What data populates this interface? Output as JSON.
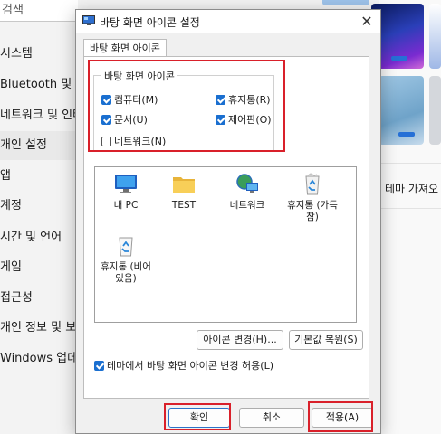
{
  "background": {
    "search_placeholder": "검색",
    "nav": [
      {
        "label": "시스템"
      },
      {
        "label": "Bluetooth 및 장치"
      },
      {
        "label": "네트워크 및 인터넷"
      },
      {
        "label": "개인 설정"
      },
      {
        "label": "앱"
      },
      {
        "label": "계정"
      },
      {
        "label": "시간 및 언어"
      },
      {
        "label": "게임"
      },
      {
        "label": "접근성"
      },
      {
        "label": "개인 정보 및 보안"
      },
      {
        "label": "Windows 업데이트"
      }
    ],
    "theme_text": "테마 가져오"
  },
  "dialog": {
    "title": "바탕 화면 아이콘 설정",
    "close_label": "✕",
    "tab": "바탕 화면 아이콘",
    "group_title": "바탕 화면 아이콘",
    "checkboxes": [
      {
        "label": "컴퓨터(M)",
        "checked": true
      },
      {
        "label": "휴지통(R)",
        "checked": true
      },
      {
        "label": "문서(U)",
        "checked": true
      },
      {
        "label": "제어판(O)",
        "checked": true
      },
      {
        "label": "네트워크(N)",
        "checked": false
      }
    ],
    "icons": [
      {
        "label": "내 PC",
        "icon": "monitor-icon"
      },
      {
        "label": "TEST",
        "icon": "folder-icon"
      },
      {
        "label": "네트워크",
        "icon": "network-icon"
      },
      {
        "label": "휴지통 (가득 참)",
        "icon": "recycle-bin-full-icon"
      },
      {
        "label": "휴지통 (비어 있음)",
        "icon": "recycle-bin-empty-icon"
      }
    ],
    "change_icon_button": "아이콘 변경(H)...",
    "restore_default_button": "기본값 복원(S)",
    "allow_themes": {
      "label": "테마에서 바탕 화면 아이콘 변경 허용(L)",
      "checked": true
    },
    "ok_button": "확인",
    "cancel_button": "취소",
    "apply_button": "적용(A)"
  },
  "colors": {
    "accent": "#1a6fd0",
    "highlight": "#d9202a"
  }
}
